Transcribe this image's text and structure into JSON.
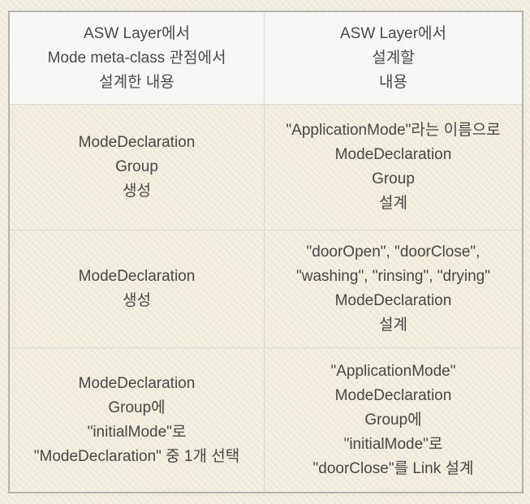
{
  "colors": {
    "page_background": "#f0ebdc",
    "header_background": "#f7f7f6",
    "outer_border": "#b3b3b3",
    "inner_border": "#d9d8d2",
    "text": "#474747"
  },
  "table": {
    "header": {
      "left": [
        "ASW Layer에서",
        "Mode meta-class 관점에서",
        "설계한 내용"
      ],
      "right": [
        "ASW Layer에서",
        "설계할",
        "내용"
      ]
    },
    "rows": [
      {
        "left": [
          "ModeDeclaration",
          "Group",
          "생성"
        ],
        "right": [
          "\"ApplicationMode\"라는 이름으로",
          "ModeDeclaration",
          "Group",
          "설계"
        ]
      },
      {
        "left": [
          "ModeDeclaration",
          "생성"
        ],
        "right": [
          "\"doorOpen\", \"doorClose\",",
          "\"washing\", \"rinsing\", \"drying\"",
          "ModeDeclaration",
          "설계"
        ]
      },
      {
        "left": [
          "ModeDeclaration",
          "Group에",
          "\"initialMode\"로",
          "\"ModeDeclaration\" 중 1개 선택"
        ],
        "right": [
          "\"ApplicationMode\"",
          "ModeDeclaration",
          "Group에",
          "\"initialMode\"로",
          "\"doorClose\"를 Link 설계"
        ]
      }
    ]
  }
}
